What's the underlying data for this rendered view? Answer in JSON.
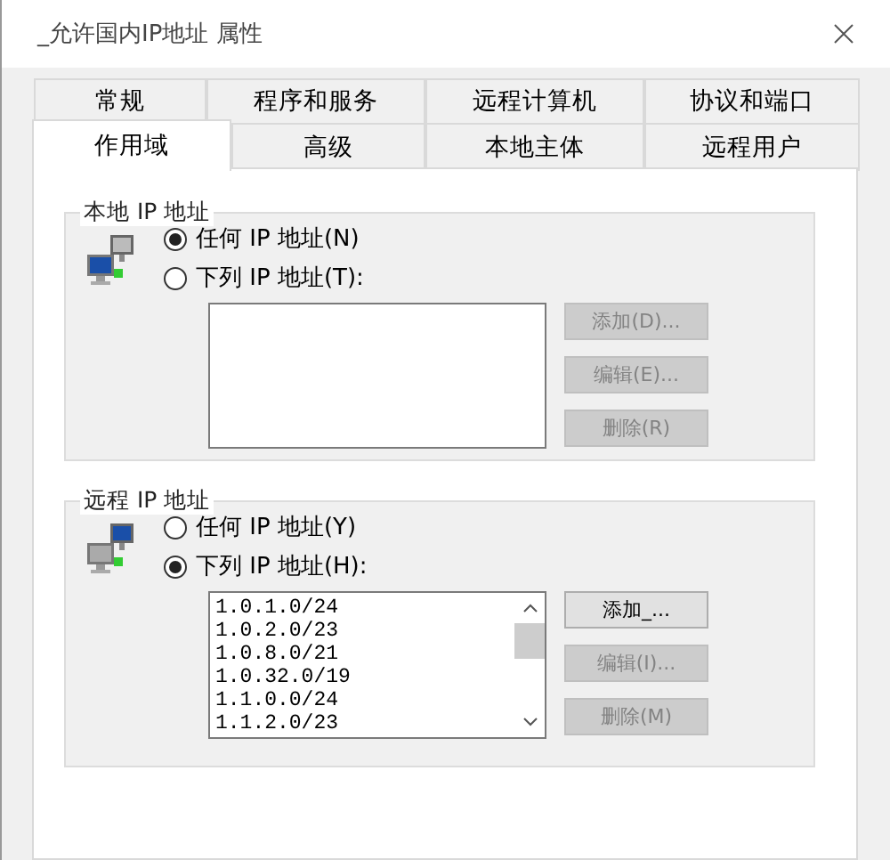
{
  "window": {
    "title": "_允许国内IP地址 属性"
  },
  "tab_rows": [
    [
      {
        "label": "常规",
        "selected": false
      },
      {
        "label": "程序和服务",
        "selected": false
      },
      {
        "label": "远程计算机",
        "selected": false
      },
      {
        "label": "协议和端口",
        "selected": false
      }
    ],
    [
      {
        "label": "作用域",
        "selected": true
      },
      {
        "label": "高级",
        "selected": false
      },
      {
        "label": "本地主体",
        "selected": false
      },
      {
        "label": "远程用户",
        "selected": false
      }
    ]
  ],
  "groups": [
    {
      "title": "本地 IP 地址",
      "options": [
        {
          "label": "任何 IP 地址(N)",
          "selected": true
        },
        {
          "label": "下列 IP 地址(T):",
          "selected": false
        }
      ],
      "scrollbar": false,
      "buttons": [
        {
          "label": "添加(D)...",
          "disabled": true
        },
        {
          "label": "编辑(E)...",
          "disabled": true
        },
        {
          "label": "删除(R)",
          "disabled": true
        }
      ]
    },
    {
      "title": "远程 IP 地址",
      "options": [
        {
          "label": "任何 IP 地址(Y)",
          "selected": false
        },
        {
          "label": "下列 IP 地址(H):",
          "selected": true
        }
      ],
      "addresses": [
        "1.0.1.0/24",
        "1.0.2.0/23",
        "1.0.8.0/21",
        "1.0.32.0/19",
        "1.1.0.0/24",
        "1.1.2.0/23"
      ],
      "scrollbar": true,
      "buttons": [
        {
          "label": "添加_...",
          "disabled": false
        },
        {
          "label": "编辑(I)...",
          "disabled": true
        },
        {
          "label": "删除(M)",
          "disabled": true
        }
      ]
    }
  ]
}
